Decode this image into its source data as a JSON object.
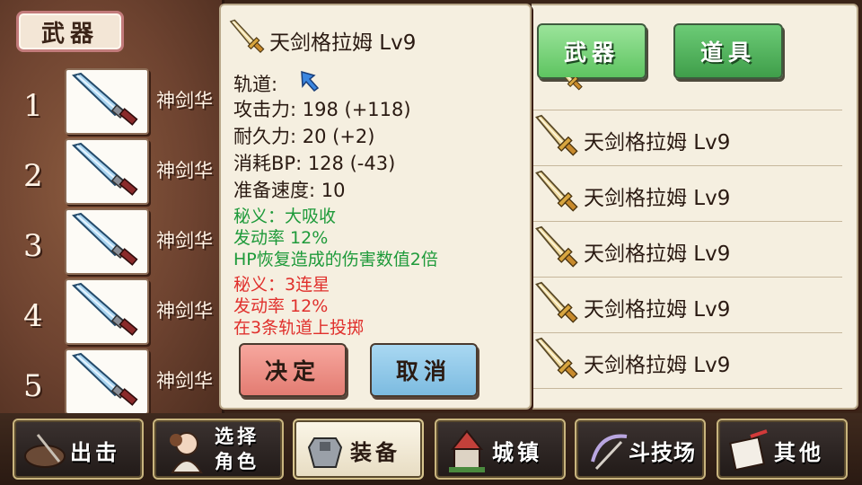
{
  "left": {
    "header": "武器",
    "slots": [
      {
        "num": "1",
        "name": "神剑华"
      },
      {
        "num": "2",
        "name": "神剑华"
      },
      {
        "num": "3",
        "name": "神剑华"
      },
      {
        "num": "4",
        "name": "神剑华"
      },
      {
        "num": "5",
        "name": "神剑华"
      }
    ]
  },
  "detail": {
    "title": "天剑格拉姆 Lv9",
    "track_label": "轨道:",
    "stats": [
      "攻击力: 198 (+118)",
      "耐久力: 20 (+2)",
      "消耗BP: 128 (-43)",
      "准备速度: 10"
    ],
    "special1": [
      "秘义：大吸收",
      "发动率 12%",
      "HP恢复造成的伤害数值2倍"
    ],
    "special2": [
      "秘义：3连星",
      "发动率 12%",
      "在3条轨道上投掷"
    ],
    "confirm": "决定",
    "cancel": "取消"
  },
  "list": {
    "tabs": {
      "weapon": "武器",
      "item": "道具"
    },
    "items": [
      "天剑格拉姆 Lv9",
      "天剑格拉姆 Lv9",
      "天剑格拉姆 Lv9",
      "天剑格拉姆 Lv9",
      "天剑格拉姆 Lv9"
    ]
  },
  "nav": {
    "sortie": "出击",
    "select_char": "选择\n角色",
    "equip": "装备",
    "town": "城镇",
    "arena": "斗技场",
    "other": "其他"
  },
  "colors": {
    "special_green": "#1e9a3a",
    "special_red": "#e0302c",
    "tab_green": "#5ec461"
  }
}
